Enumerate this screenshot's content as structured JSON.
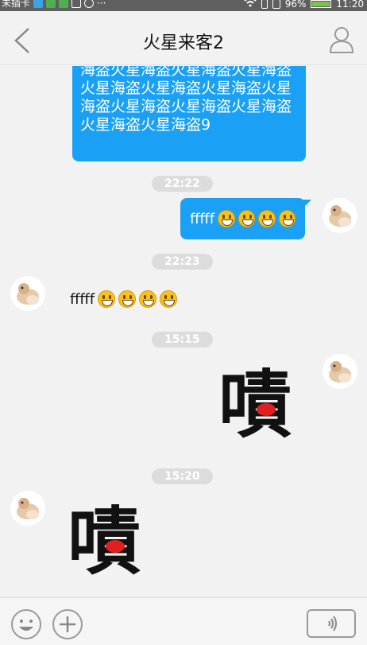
{
  "status_bar": {
    "carrier": "未插卡",
    "battery": "96%",
    "time": "11:20",
    "icons": [
      "image-icon",
      "chat-icon",
      "chat-icon",
      "keyboard-icon",
      "recorder-icon",
      "more-icon",
      "wifi-icon",
      "vibrate-icon",
      "sim-icon",
      "battery-icon"
    ]
  },
  "header": {
    "title": "火星来客2",
    "back_icon": "back-chevron-icon",
    "profile_icon": "person-icon"
  },
  "messages": [
    {
      "type": "text",
      "side": "right",
      "text": "海盗火星海盗火星海盗火星海盗火星海盗火星海盗火星海盗火星海盗火星海盗火星海盗火星海盗火星海盗火星海盗9"
    },
    {
      "type": "time",
      "text": "22:22"
    },
    {
      "type": "text",
      "side": "right",
      "text": "fffff",
      "emoji_count": 4
    },
    {
      "type": "time",
      "text": "22:23"
    },
    {
      "type": "text",
      "side": "left",
      "text": "fffff",
      "emoji_count": 4
    },
    {
      "type": "time",
      "text": "15:15"
    },
    {
      "type": "sticker",
      "side": "right",
      "text": "嘖"
    },
    {
      "type": "time",
      "text": "15:20"
    },
    {
      "type": "sticker",
      "side": "left",
      "text": "嘖"
    }
  ],
  "bottom_bar": {
    "emoji_icon": "smiley-icon",
    "add_icon": "plus-icon",
    "voice_icon": "sound-wave-icon"
  },
  "colors": {
    "bubble": "#1aa1f6",
    "background": "#f2f2f2",
    "status_bar": "#5f5f5f"
  }
}
